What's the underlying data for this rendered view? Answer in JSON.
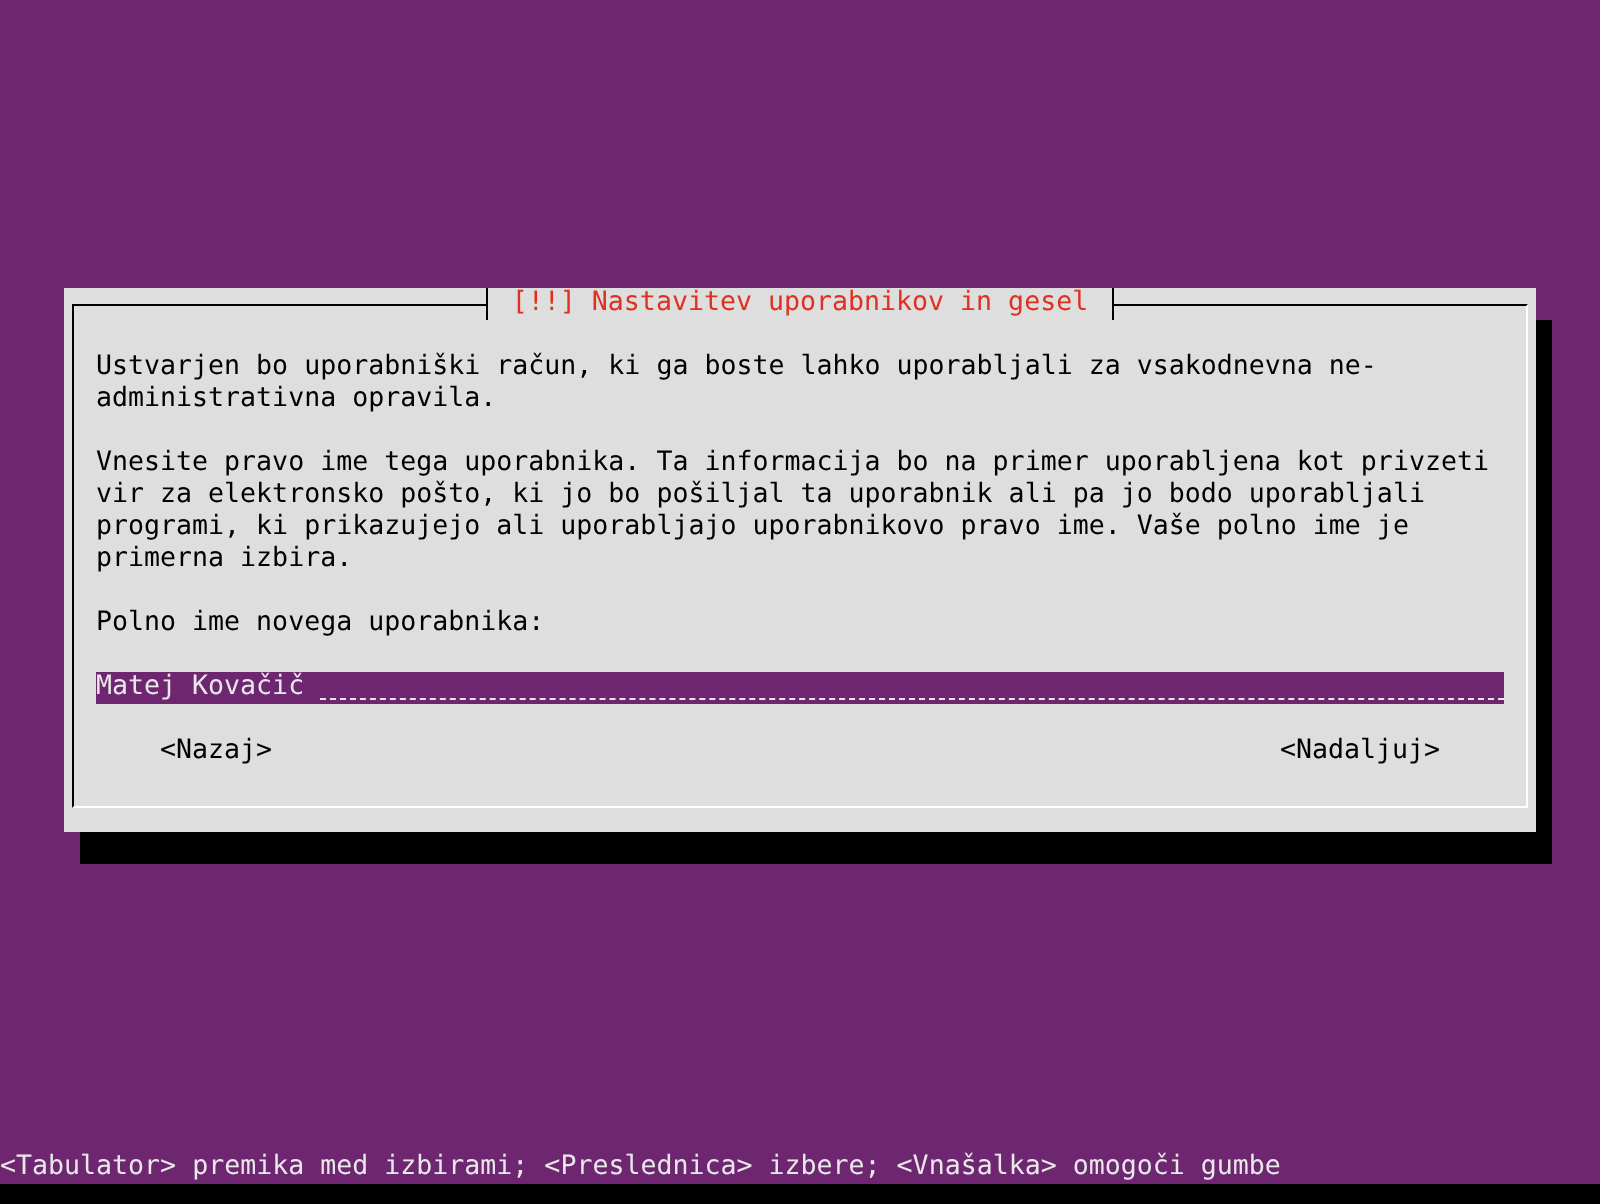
{
  "dialog": {
    "title": "[!!] Nastavitev uporabnikov in gesel",
    "paragraphs": [
      "Ustvarjen bo uporabniški račun, ki ga boste lahko uporabljali za vsakodnevna ne-administrativna opravila.",
      "Vnesite pravo ime tega uporabnika. Ta informacija bo na primer uporabljena kot privzeti vir za elektronsko pošto, ki jo bo pošiljal ta uporabnik ali pa jo bodo uporabljali programi, ki prikazujejo ali uporabljajo uporabnikovo pravo ime. Vaše polno ime je primerna izbira."
    ],
    "field": {
      "label": "Polno ime novega uporabnika:",
      "value": "Matej Kovačič"
    },
    "buttons": [
      {
        "label": "<Nazaj>"
      },
      {
        "label": "<Nadaljuj>"
      }
    ]
  },
  "status_bar": "<Tabulator> premika med izbirami; <Preslednica> izbere; <Vnašalka> omogoči gumbe"
}
